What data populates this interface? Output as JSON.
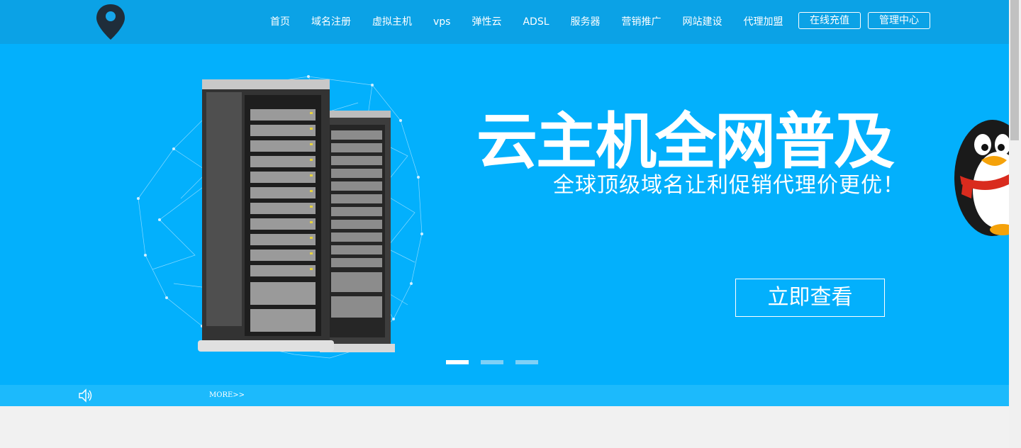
{
  "header": {
    "logo_icon": "map-pin-icon",
    "nav": [
      {
        "label": "首页"
      },
      {
        "label": "域名注册"
      },
      {
        "label": "虚拟主机"
      },
      {
        "label": "vps"
      },
      {
        "label": "弹性云"
      },
      {
        "label": "ADSL"
      },
      {
        "label": "服务器"
      },
      {
        "label": "营销推广"
      },
      {
        "label": "网站建设"
      },
      {
        "label": "代理加盟"
      }
    ],
    "recharge_label": "在线充值",
    "admin_label": "管理中心"
  },
  "banner": {
    "headline": "云主机全网普及",
    "subline": "全球顶级域名让利促销代理价更优！",
    "cta_label": "立即查看",
    "slide_count": 3,
    "active_slide": 1
  },
  "notice": {
    "speaker_icon": "speaker-icon",
    "more_label": "MORE>>"
  },
  "colors": {
    "header_bg": "#0ba2e6",
    "banner_bg": "#03b0fc",
    "notice_bg": "#1cbafc",
    "page_bg": "#f1f1f1"
  }
}
